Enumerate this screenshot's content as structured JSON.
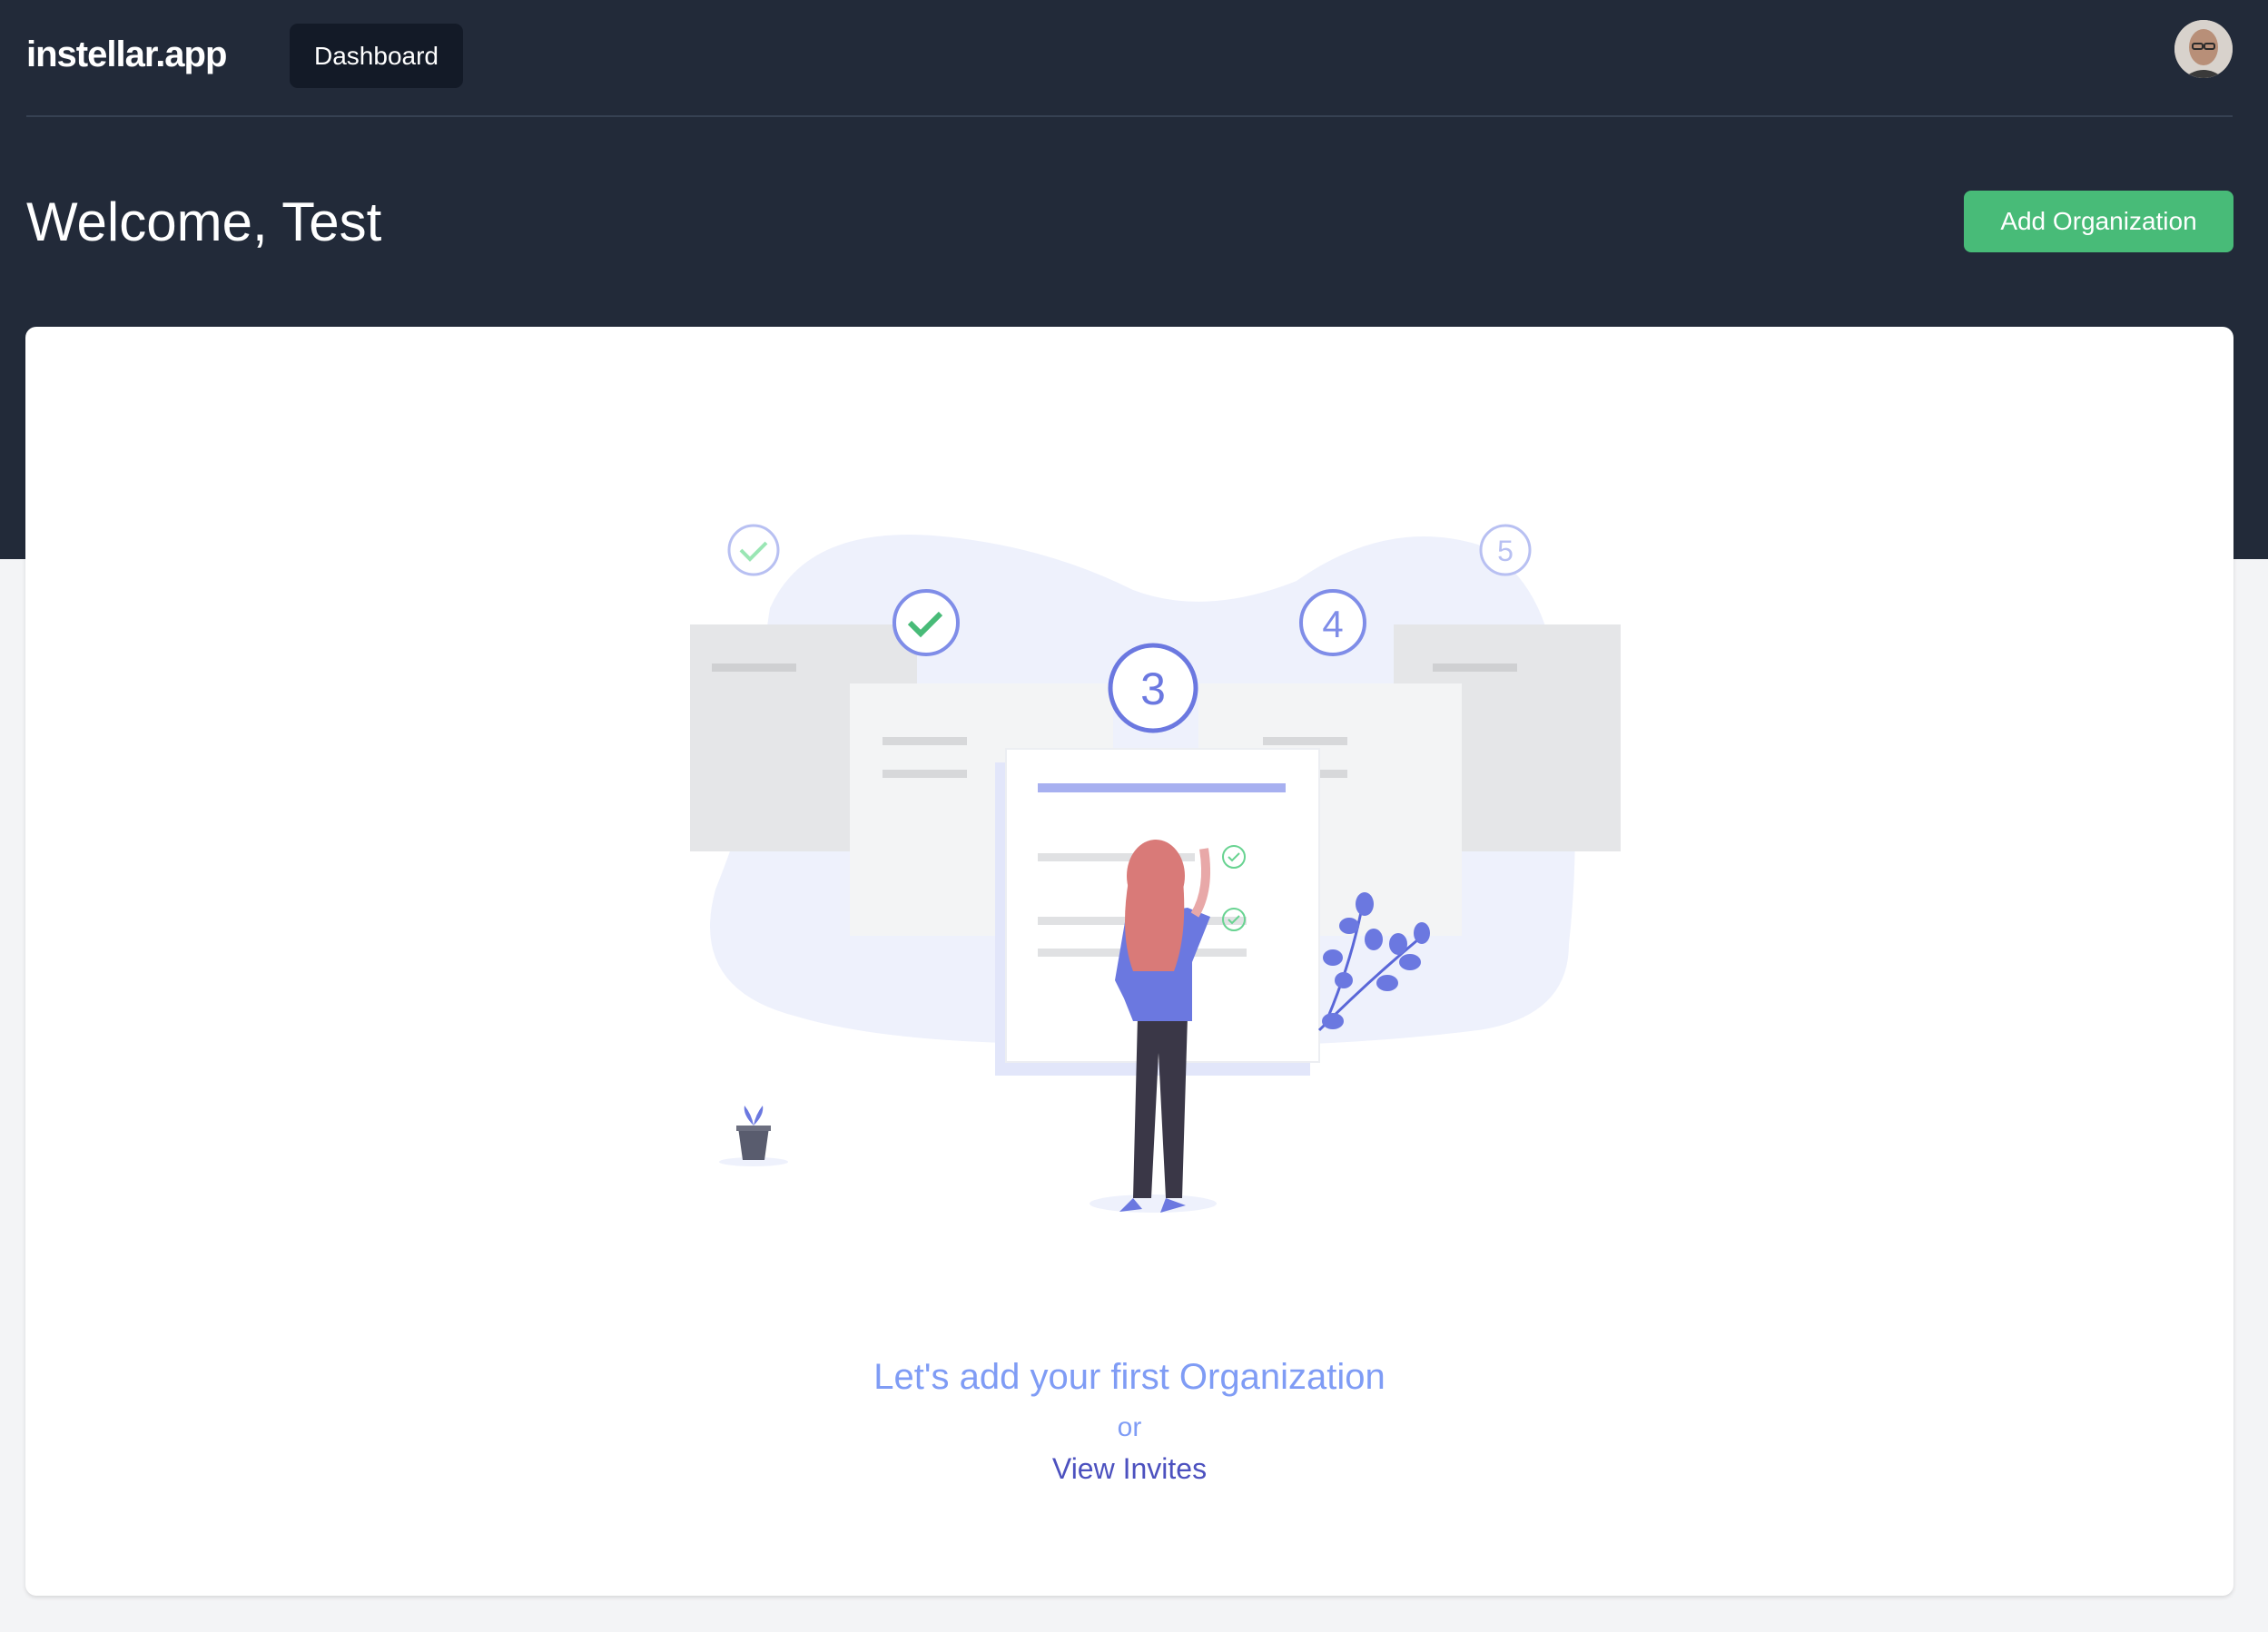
{
  "app": {
    "name": "instellar.app"
  },
  "nav": {
    "dashboard_label": "Dashboard"
  },
  "user": {
    "avatar_icon": "user-avatar"
  },
  "header": {
    "welcome": "Welcome, Test",
    "add_org_label": "Add Organization"
  },
  "illustration": {
    "steps": [
      "3",
      "4",
      "5"
    ]
  },
  "empty_state": {
    "title": "Let's add your first Organization",
    "or_text": "or",
    "invites_link": "View Invites"
  },
  "colors": {
    "header_bg": "#222a39",
    "accent_green": "#48bb78",
    "indigo_light": "#7f9cf5",
    "indigo_dark": "#4c51bf"
  }
}
